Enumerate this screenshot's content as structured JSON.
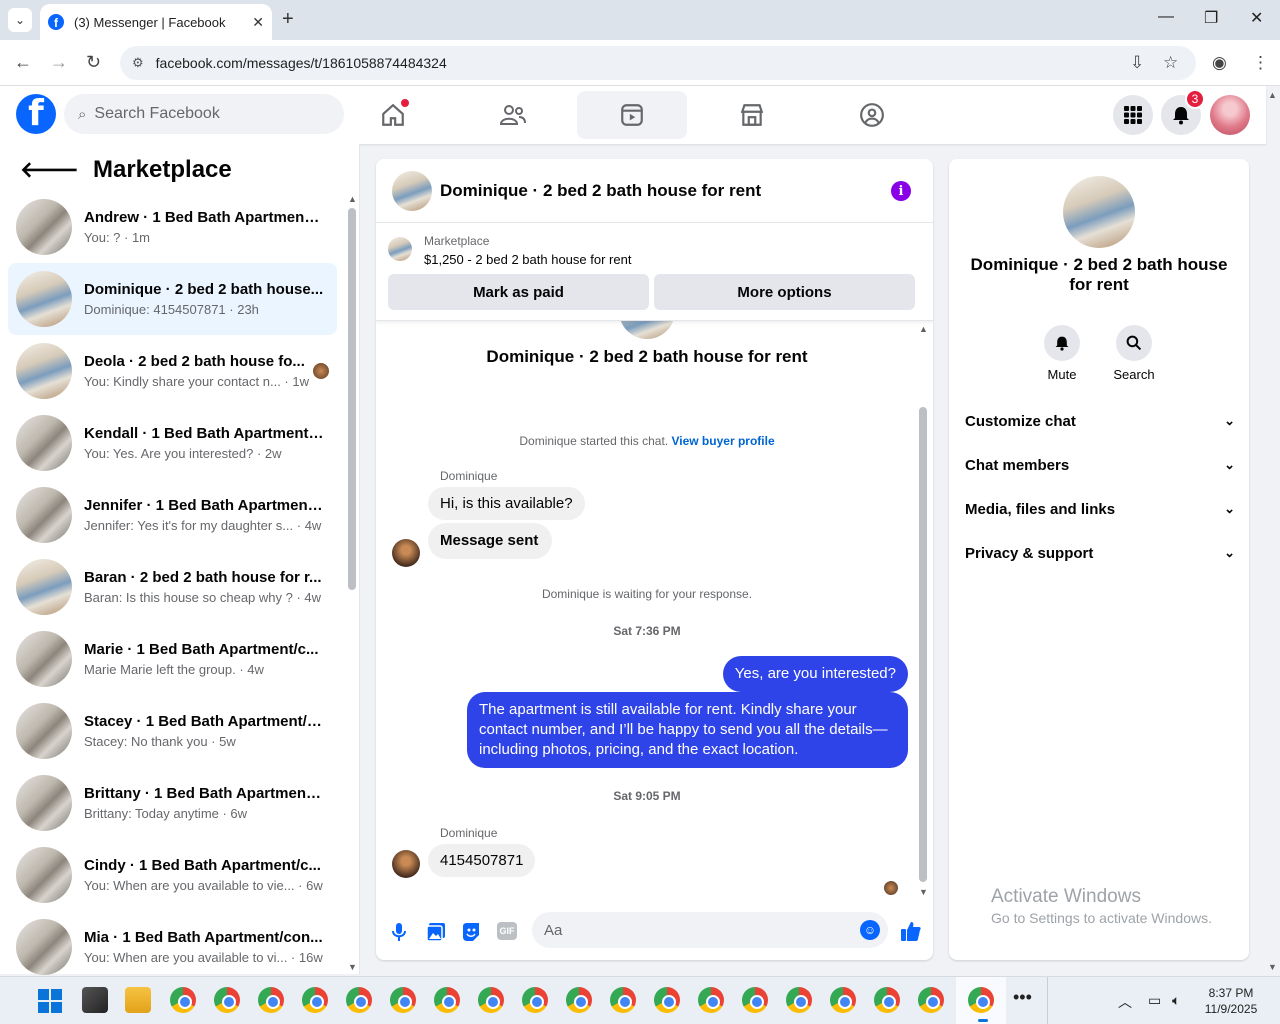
{
  "browser": {
    "tab_title": "(3) Messenger | Facebook",
    "url": "facebook.com/messages/t/1861058874484324"
  },
  "fb_header": {
    "search_placeholder": "Search Facebook",
    "notification_count": "3"
  },
  "sidebar": {
    "title": "Marketplace",
    "conversations": [
      {
        "name": "Andrew · 1 Bed Bath Apartment/...",
        "preview": "You: ? · 1m"
      },
      {
        "name": "Dominique · 2 bed 2 bath house...",
        "preview": "Dominique: 4154507871 · 23h"
      },
      {
        "name": "Deola · 2 bed 2 bath house fo...",
        "preview": "You: Kindly share your contact n... · 1w"
      },
      {
        "name": "Kendall · 1 Bed Bath Apartment/...",
        "preview": "You: Yes. Are you interested? · 2w"
      },
      {
        "name": "Jennifer · 1 Bed Bath Apartment...",
        "preview": "Jennifer: Yes it's for my daughter s... · 4w"
      },
      {
        "name": "Baran · 2 bed 2 bath house for r...",
        "preview": "Baran: Is this house so cheap why ? · 4w"
      },
      {
        "name": "Marie · 1 Bed Bath Apartment/c...",
        "preview": "Marie Marie left the group. · 4w"
      },
      {
        "name": "Stacey · 1 Bed Bath Apartment/c...",
        "preview": "Stacey: No thank you · 5w"
      },
      {
        "name": "Brittany · 1 Bed Bath Apartment/...",
        "preview": "Brittany: Today anytime · 6w"
      },
      {
        "name": "Cindy · 1 Bed Bath Apartment/c...",
        "preview": "You: When are you available to vie... · 6w"
      },
      {
        "name": "Mia · 1 Bed Bath Apartment/con...",
        "preview": "You: When are you available to vi... · 16w"
      }
    ]
  },
  "chat": {
    "title": "Dominique · 2 bed 2 bath house for rent",
    "marketplace_label": "Marketplace",
    "listing": "$1,250 - 2 bed 2 bath house for rent",
    "mark_paid_label": "Mark as paid",
    "more_options_label": "More options",
    "center_title": "Dominique · 2 bed 2 bath house for rent",
    "started_text": "Dominique started this chat.",
    "view_buyer_profile": "View buyer profile",
    "sender_name": "Dominique",
    "msg1": "Hi, is this available?",
    "msg2": "Message sent",
    "waiting_text": "Dominique is waiting for your response.",
    "time1": "Sat 7:36 PM",
    "out1": "Yes, are you interested?",
    "out2": "The apartment is still available for rent. Kindly share your contact number, and I’ll be happy to send you all the details—including photos, pricing, and the exact location.",
    "time2": "Sat 9:05 PM",
    "sender_name2": "Dominique",
    "msg3": "4154507871",
    "composer_placeholder": "Aa",
    "gif_label": "GIF"
  },
  "right_panel": {
    "name": "Dominique · 2 bed 2 bath house for rent",
    "mute_label": "Mute",
    "search_label": "Search",
    "rows": [
      "Customize chat",
      "Chat members",
      "Media, files and links",
      "Privacy & support"
    ]
  },
  "watermark": {
    "line1": "Activate Windows",
    "line2": "Go to Settings to activate Windows."
  },
  "taskbar": {
    "time": "8:37 PM",
    "date": "11/9/2025"
  },
  "colors": {
    "fb_blue": "#0866ff",
    "outgoing_bubble": "#2f44e8",
    "notification_red": "#e41e3f",
    "info_purple": "#8a00e6"
  }
}
